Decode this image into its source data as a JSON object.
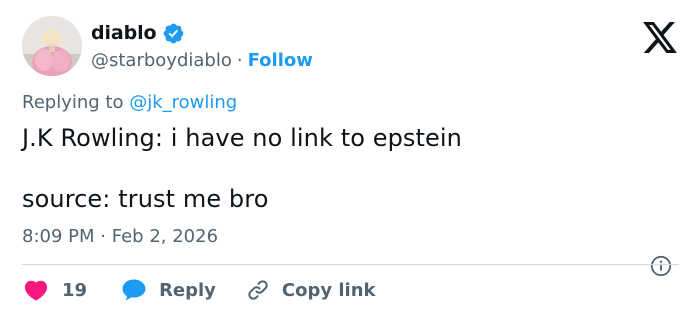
{
  "author": {
    "display_name": "diablo",
    "handle": "@starboydiablo",
    "separator": "·",
    "follow_label": "Follow",
    "verified": true
  },
  "reply_context": {
    "prefix": "Replying to ",
    "mention": "@jk_rowling"
  },
  "tweet": {
    "line1": "J.K Rowling: i have no link to epstein",
    "line2": "source: trust me bro"
  },
  "meta": {
    "time": "8:09 PM",
    "separator": "·",
    "date": "Feb 2, 2026"
  },
  "actions": {
    "like_count": "19",
    "reply_label": "Reply",
    "copy_label": "Copy link"
  },
  "colors": {
    "accent": "#1d9bf0",
    "like": "#f91880",
    "text": "#0f1419",
    "muted": "#536471",
    "divider": "#cfd9de"
  },
  "icons": {
    "verified": "verified-badge-icon",
    "platform": "x-logo-icon",
    "info": "info-icon",
    "like": "heart-icon",
    "reply": "speech-bubble-icon",
    "copy": "link-icon"
  }
}
